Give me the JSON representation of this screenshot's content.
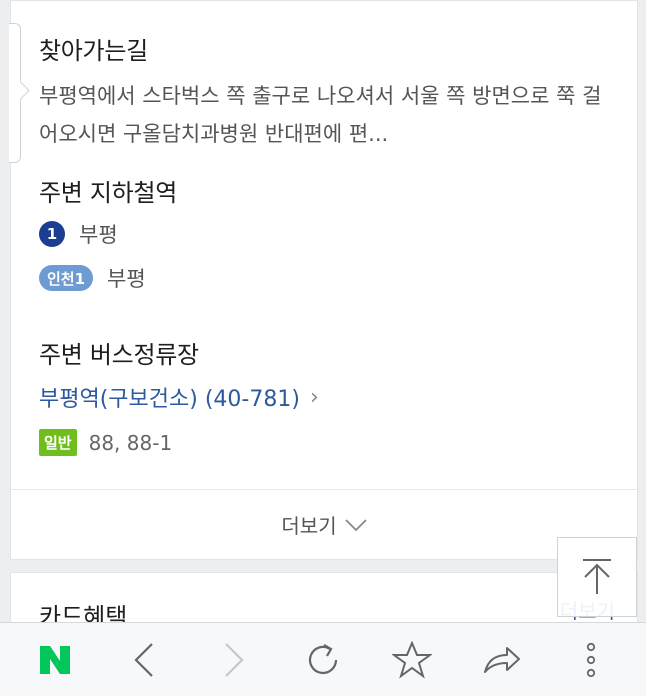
{
  "directions": {
    "title": "찾아가는길",
    "text": "부평역에서 스타벅스 쪽 출구로 나오셔서 서울 쪽 방면으로 쭉 걸어오시면 구올담치과병원 반대편에 편..."
  },
  "subway": {
    "title": "주변 지하철역",
    "lines": [
      {
        "badge": "1",
        "station": "부평",
        "color": "#1d3d92"
      },
      {
        "badge": "인천1",
        "station": "부평",
        "color": "#6e9bd1"
      }
    ]
  },
  "bus": {
    "title": "주변 버스정류장",
    "stop_label": "부평역(구보건소) (40-781)",
    "badge": "일반",
    "badge_color": "#6fbe1e",
    "numbers": "88, 88-1"
  },
  "more": {
    "label": "더보기"
  },
  "card_benefit": {
    "title": "카드혜택",
    "more_label": "더보기"
  },
  "bottom_bar": {
    "logo": "N",
    "logo_color": "#03c75a",
    "icons": [
      "back-icon",
      "forward-icon",
      "refresh-icon",
      "bookmark-star-icon",
      "share-icon",
      "more-vertical-icon"
    ]
  },
  "scroll_top": {
    "icon": "scroll-to-top-icon"
  }
}
